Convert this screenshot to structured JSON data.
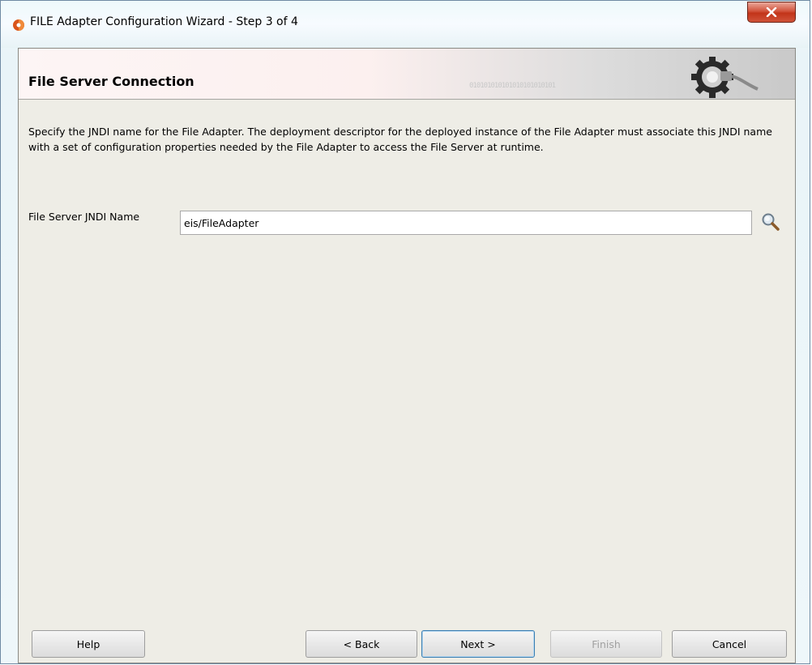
{
  "window": {
    "title": "FILE Adapter Configuration Wizard - Step 3 of 4",
    "close_icon": "close-icon"
  },
  "header": {
    "title": "File Server Connection",
    "decoration_binary": "010101010101010101010101",
    "icon": "gear-icon"
  },
  "main": {
    "description": "Specify the JNDI name for the File Adapter. The deployment descriptor for the deployed instance of the File Adapter must associate this JNDI name with a set of configuration properties needed by the File Adapter to access the File Server at runtime.",
    "jndi_label": "File Server JNDI Name",
    "jndi_value": "eis/FileAdapter",
    "search_icon": "search-icon"
  },
  "buttons": {
    "help": "Help",
    "back": "< Back",
    "next": "Next >",
    "finish": "Finish",
    "cancel": "Cancel"
  }
}
